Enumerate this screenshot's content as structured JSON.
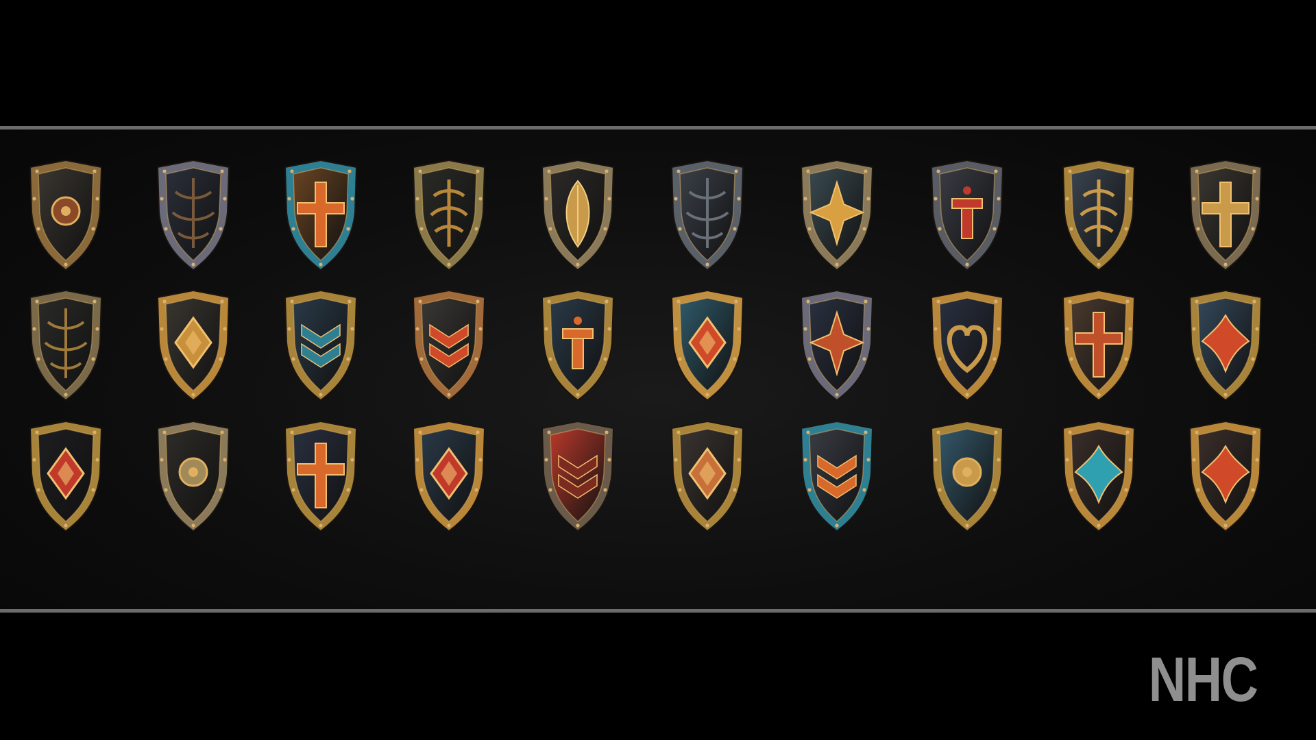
{
  "watermark": "NHC",
  "palette": {
    "metal_gold": "#b8873a",
    "metal_bronze": "#8a5a2a",
    "steel_dark": "#2f343c",
    "steel_blue": "#2c4a5c",
    "teal": "#2f7f93",
    "red": "#c0392b",
    "orange": "#d9682b",
    "rule": "#6b6b6b"
  },
  "shields": [
    {
      "name": "shield-bronze-boss-icon",
      "row": 1,
      "col": 1,
      "face": "#3a3630",
      "rim": "#8a6a3a",
      "emblem": "boss",
      "accent": "#8a4a2a"
    },
    {
      "name": "shield-steel-filigree-icon",
      "row": 1,
      "col": 2,
      "face": "#2b2f3a",
      "rim": "#6a6a78",
      "emblem": "filigree",
      "accent": "#7a5a3a"
    },
    {
      "name": "shield-teal-cross-icon",
      "row": 1,
      "col": 3,
      "face": "#6a4422",
      "rim": "#2f7f93",
      "emblem": "cross",
      "accent": "#d9682b"
    },
    {
      "name": "shield-oval-gold-scroll-icon",
      "row": 1,
      "col": 4,
      "face": "#2a2a26",
      "rim": "#8a7a4a",
      "emblem": "scroll",
      "accent": "#b8873a"
    },
    {
      "name": "shield-gold-leaf-icon",
      "row": 1,
      "col": 5,
      "face": "#2c2a28",
      "rim": "#8a7a5a",
      "emblem": "leaf",
      "accent": "#c89a4a"
    },
    {
      "name": "shield-horned-steel-icon",
      "row": 1,
      "col": 6,
      "face": "#3a4048",
      "rim": "#5a6068",
      "emblem": "filigree",
      "accent": "#6a7078"
    },
    {
      "name": "shield-teal-gold-star-icon",
      "row": 1,
      "col": 7,
      "face": "#3a4a50",
      "rim": "#8a7a5a",
      "emblem": "star",
      "accent": "#d8a040"
    },
    {
      "name": "shield-red-rune-icon",
      "row": 1,
      "col": 8,
      "face": "#3a3c44",
      "rim": "#5a5c64",
      "emblem": "rune",
      "accent": "#c0392b"
    },
    {
      "name": "shield-blue-gold-ornate-icon",
      "row": 1,
      "col": 9,
      "face": "#3a4450",
      "rim": "#a8843a",
      "emblem": "scroll",
      "accent": "#c89a4a"
    },
    {
      "name": "shield-gold-cross-icon",
      "row": 1,
      "col": 10,
      "face": "#3a3630",
      "rim": "#7a6a50",
      "emblem": "cross",
      "accent": "#c89a4a"
    },
    {
      "name": "shield-winged-bronze-icon",
      "row": 2,
      "col": 1,
      "face": "#2a2a28",
      "rim": "#7a6a4a",
      "emblem": "filigree",
      "accent": "#a07a3a"
    },
    {
      "name": "shield-gold-diamond-icon",
      "row": 2,
      "col": 2,
      "face": "#3a3630",
      "rim": "#b8873a",
      "emblem": "diamond",
      "accent": "#c8903a"
    },
    {
      "name": "shield-teal-weave-icon",
      "row": 2,
      "col": 3,
      "face": "#2a3a48",
      "rim": "#a8843a",
      "emblem": "chevron",
      "accent": "#2f7f93"
    },
    {
      "name": "shield-red-chevron-icon",
      "row": 2,
      "col": 4,
      "face": "#3a3834",
      "rim": "#a06a3a",
      "emblem": "chevron",
      "accent": "#d04a2a"
    },
    {
      "name": "shield-blue-rune-icon",
      "row": 2,
      "col": 5,
      "face": "#2a3a48",
      "rim": "#a8843a",
      "emblem": "rune",
      "accent": "#d9682b"
    },
    {
      "name": "shield-teal-gold-filigree-icon",
      "row": 2,
      "col": 6,
      "face": "#2f5a6a",
      "rim": "#c09040",
      "emblem": "diamond",
      "accent": "#d04a2a"
    },
    {
      "name": "shield-navy-red-crest-icon",
      "row": 2,
      "col": 7,
      "face": "#2a3040",
      "rim": "#6a6a78",
      "emblem": "star",
      "accent": "#c0502a"
    },
    {
      "name": "shield-heart-emblem-icon",
      "row": 2,
      "col": 8,
      "face": "#2a3040",
      "rim": "#b8873a",
      "emblem": "heart",
      "accent": "#c89a4a"
    },
    {
      "name": "shield-octagon-cross-icon",
      "row": 2,
      "col": 9,
      "face": "#4a3a2e",
      "rim": "#b8873a",
      "emblem": "cross",
      "accent": "#c0502a"
    },
    {
      "name": "shield-blue-fleur-icon",
      "row": 2,
      "col": 10,
      "face": "#34485a",
      "rim": "#a8843a",
      "emblem": "fleur",
      "accent": "#d04a2a"
    },
    {
      "name": "shield-red-ruby-icon",
      "row": 3,
      "col": 1,
      "face": "#1e1e22",
      "rim": "#a8843a",
      "emblem": "diamond",
      "accent": "#c0392b"
    },
    {
      "name": "shield-bronze-medallion-icon",
      "row": 3,
      "col": 2,
      "face": "#2e2c28",
      "rim": "#8a7a5a",
      "emblem": "boss",
      "accent": "#a08a5a"
    },
    {
      "name": "shield-navy-cross-icon",
      "row": 3,
      "col": 3,
      "face": "#2a3040",
      "rim": "#a8843a",
      "emblem": "cross",
      "accent": "#d9682b"
    },
    {
      "name": "shield-blue-studded-icon",
      "row": 3,
      "col": 4,
      "face": "#2a3a48",
      "rim": "#b8873a",
      "emblem": "diamond",
      "accent": "#c0392b"
    },
    {
      "name": "shield-red-knotwork-icon",
      "row": 3,
      "col": 5,
      "face": "#b8392b",
      "rim": "#6a5a4a",
      "emblem": "chevron",
      "accent": "#7a2a1e"
    },
    {
      "name": "shield-bronze-geometric-icon",
      "row": 3,
      "col": 6,
      "face": "#3a3430",
      "rim": "#a8843a",
      "emblem": "diamond",
      "accent": "#c8703a"
    },
    {
      "name": "shield-orange-wave-icon",
      "row": 3,
      "col": 7,
      "face": "#3a3c44",
      "rim": "#2f7f93",
      "emblem": "chevron",
      "accent": "#d9682b"
    },
    {
      "name": "shield-teal-gold-boss-icon",
      "row": 3,
      "col": 8,
      "face": "#34586a",
      "rim": "#a8843a",
      "emblem": "boss",
      "accent": "#c89a4a"
    },
    {
      "name": "shield-teal-quatrefoil-icon",
      "row": 3,
      "col": 9,
      "face": "#3a2e2a",
      "rim": "#b8873a",
      "emblem": "fleur",
      "accent": "#2fa0b0"
    },
    {
      "name": "shield-red-fleur-icon",
      "row": 3,
      "col": 10,
      "face": "#3a2e2a",
      "rim": "#b8873a",
      "emblem": "fleur",
      "accent": "#d04a2a"
    }
  ]
}
